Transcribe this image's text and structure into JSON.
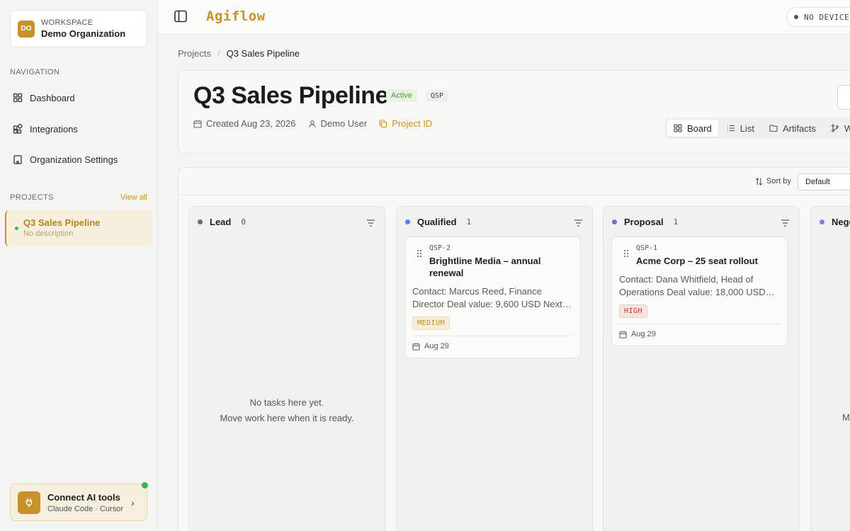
{
  "workspace": {
    "avatar": "DO",
    "label": "WORKSPACE",
    "name": "Demo Organization"
  },
  "navigation": {
    "label": "NAVIGATION",
    "items": [
      {
        "label": "Dashboard",
        "icon": "dashboard-icon"
      },
      {
        "label": "Integrations",
        "icon": "integrations-icon"
      },
      {
        "label": "Organization Settings",
        "icon": "building-icon"
      }
    ]
  },
  "projects": {
    "label": "PROJECTS",
    "view_all": "View all",
    "items": [
      {
        "name": "Q3 Sales Pipeline",
        "description": "No description"
      }
    ]
  },
  "ai_tools": {
    "title": "Connect AI tools",
    "subtitle": "Claude Code · Cursor"
  },
  "topbar": {
    "logo": "Agiflow",
    "devices": "NO DEVICES"
  },
  "breadcrumb": {
    "root": "Projects",
    "separator": "/",
    "current": "Q3 Sales Pipeline"
  },
  "project": {
    "title": "Q3 Sales Pipeline",
    "status": "Active",
    "key": "QSP",
    "created": "Created Aug 23, 2026",
    "owner": "Demo User",
    "project_id_label": "Project ID"
  },
  "views": {
    "tabs": [
      "Board",
      "List",
      "Artifacts",
      "W"
    ],
    "active": "Board"
  },
  "sort": {
    "label": "Sort by",
    "value": "Default"
  },
  "columns": [
    {
      "name": "Lead",
      "count": "0",
      "color": "#6b6b6b",
      "empty_line1": "No tasks here yet.",
      "empty_line2": "Move work here when it is ready."
    },
    {
      "name": "Qualified",
      "count": "1",
      "color": "#5b7ee5",
      "card": {
        "key": "QSP-2",
        "title": "Brightline Media – annual renewal",
        "description": "Contact: Marcus Reed, Finance Director Deal value: 9,600 USD Next…",
        "priority": "MEDIUM",
        "date": "Aug 29"
      }
    },
    {
      "name": "Proposal",
      "count": "1",
      "color": "#8a63d2",
      "card": {
        "key": "QSP-1",
        "title": "Acme Corp – 25 seat rollout",
        "description": "Contact: Dana Whitfield, Head of Operations Deal value: 18,000 USD…",
        "priority": "HIGH",
        "date": "Aug 29"
      }
    },
    {
      "name": "Nego",
      "count": "",
      "color": "#8a7ae0",
      "partial_text": "Mo"
    }
  ],
  "colors": {
    "accent": "#c8922b",
    "active_green": "#4d9a3b",
    "priority_high": "#c0392b",
    "priority_medium": "#c48a2a"
  }
}
